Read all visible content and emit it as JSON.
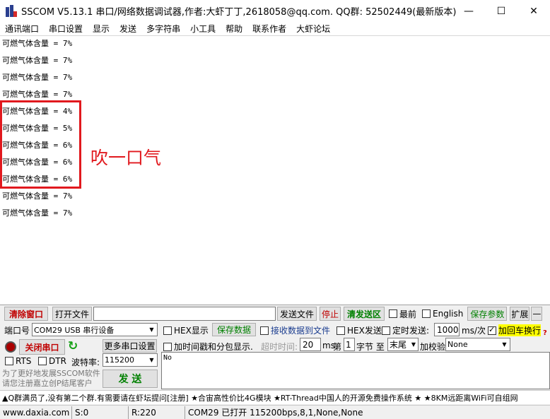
{
  "window": {
    "title": "SSCOM V5.13.1 串口/网络数据调试器,作者:大虾丁丁,2618058@qq.com. QQ群: 52502449(最新版本)",
    "minimize": "—",
    "maximize": "☐",
    "close": "✕"
  },
  "menu": [
    "通讯端口",
    "串口设置",
    "显示",
    "发送",
    "多字符串",
    "小工具",
    "帮助",
    "联系作者",
    "大虾论坛"
  ],
  "output_lines": [
    "可燃气体含量 = 7%",
    "可燃气体含量 = 7%",
    "可燃气体含量 = 7%",
    "可燃气体含量 = 7%",
    "可燃气体含量 = 4%",
    "可燃气体含量 = 5%",
    "可燃气体含量 = 6%",
    "可燃气体含量 = 6%",
    "可燃气体含量 = 6%",
    "可燃气体含量 = 7%",
    "可燃气体含量 = 7%"
  ],
  "annotation": "吹一口气",
  "toolbar": {
    "clear_window": "清除窗口",
    "open_file": "打开文件",
    "send_file": "发送文件",
    "stop": "停止",
    "clear_send": "清发送区",
    "topmost": "最前",
    "english": "English",
    "save_params": "保存参数",
    "expand": "扩展",
    "collapse": "—"
  },
  "port": {
    "port_label": "端口号",
    "port_value": "COM29 USB 串行设备",
    "close_port": "关闭串口",
    "more_settings": "更多串口设置",
    "rts": "RTS",
    "dtr": "DTR",
    "baud_label": "波特率:",
    "baud_value": "115200",
    "promo": "为了更好地发展SSCOM软件 请您注册嘉立创P结尾客户",
    "send": "发 送"
  },
  "options": {
    "hex_display": "HEX显示",
    "save_data": "保存数据",
    "recv_to_file": "接收数据到文件",
    "hex_send": "HEX发送",
    "timed_send": "定时发送:",
    "interval_value": "1000",
    "interval_unit": "ms/次",
    "append_crlf": "加回车换行",
    "timestamp": "加时间戳和分包显示.",
    "timeout_label": "超时时间:",
    "timeout_value": "20",
    "ms": "ms",
    "byte_from": "第",
    "byte_index": "1",
    "byte_to": "字节 至",
    "byte_end": "末尾",
    "checksum_label": "加校验",
    "checksum_value": "None"
  },
  "send_text": "No",
  "ticker": "▲Q群满员了,没有第二个群.有需要请在虾坛提问[注册] ★合宙高性价比4G模块 ★RT-Thread中国人的开源免费操作系统 ★ ★8KM远距离WiFi可自组网",
  "status": {
    "website": "www.daxia.com",
    "sent": "S:0",
    "received": "R:220",
    "port_status": "COM29 已打开  115200bps,8,1,None,None"
  },
  "colors": {
    "highlight_red": "#e1191e",
    "button_green": "#008000",
    "crlf_yellow": "#ffff00"
  }
}
